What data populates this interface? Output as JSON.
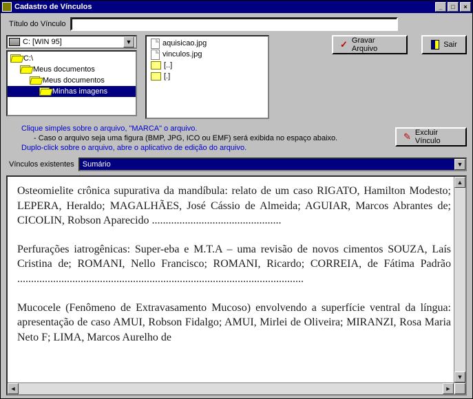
{
  "window": {
    "title": "Cadastro de Vínculos"
  },
  "form": {
    "titulo_label": "Título do Vínculo",
    "titulo_value": ""
  },
  "drive": {
    "selected": "C: [WIN 95]"
  },
  "tree": [
    {
      "indent": 0,
      "label": "C:\\",
      "open": true,
      "selected": false
    },
    {
      "indent": 1,
      "label": "Meus documentos",
      "open": true,
      "selected": false
    },
    {
      "indent": 2,
      "label": "Meus documentos",
      "open": true,
      "selected": false
    },
    {
      "indent": 3,
      "label": "Minhas imagens",
      "open": true,
      "selected": true
    }
  ],
  "files": [
    {
      "type": "file",
      "label": "aquisicao.jpg"
    },
    {
      "type": "file",
      "label": "vinculos.jpg"
    },
    {
      "type": "folder",
      "label": "[..]"
    },
    {
      "type": "folder",
      "label": "[.]"
    }
  ],
  "buttons": {
    "gravar": "Gravar Arquivo",
    "sair": "Sair",
    "excluir": "Excluir Vínculo"
  },
  "hints": {
    "line1": "Clique simples sobre o arquivo, \"MARCA\" o arquivo.",
    "line2": "- Caso o arquivo seja uma figura (BMP, JPG, ICO ou EMF) será exibida no espaço abaixo.",
    "line3": "Duplo-click sobre o arquivo, abre o aplicativo de edição do arquivo."
  },
  "vinculos": {
    "label": "Vínculos existentes",
    "selected": "Sumário"
  },
  "document": {
    "p1": "Osteomielite crônica supurativa da mandíbula: relato de um caso\nRIGATO, Hamilton Modesto; LEPERA, Heraldo; MAGALHÃES, José Cássio de Almeida; AGUIAR, Marcos Abrantes de; CICOLIN, Robson Aparecido ...............................................",
    "p2": "Perfurações iatrogênicas: Super-eba e M.T.A – uma revisão de novos cimentos\nSOUZA, Laís Cristina de; ROMANI, Nello Francisco; ROMANI, Ricardo; CORREIA, de Fátima Padrão ........................................................................................................",
    "p3": "Mucocele (Fenômeno de Extravasamento Mucoso) envolvendo a superfície ventral da língua: apresentação de caso\nAMUI, Robson Fidalgo; AMUI, Mirlei de Oliveira; MIRANZI, Rosa Maria Neto F; LIMA, Marcos Aurelho de"
  }
}
